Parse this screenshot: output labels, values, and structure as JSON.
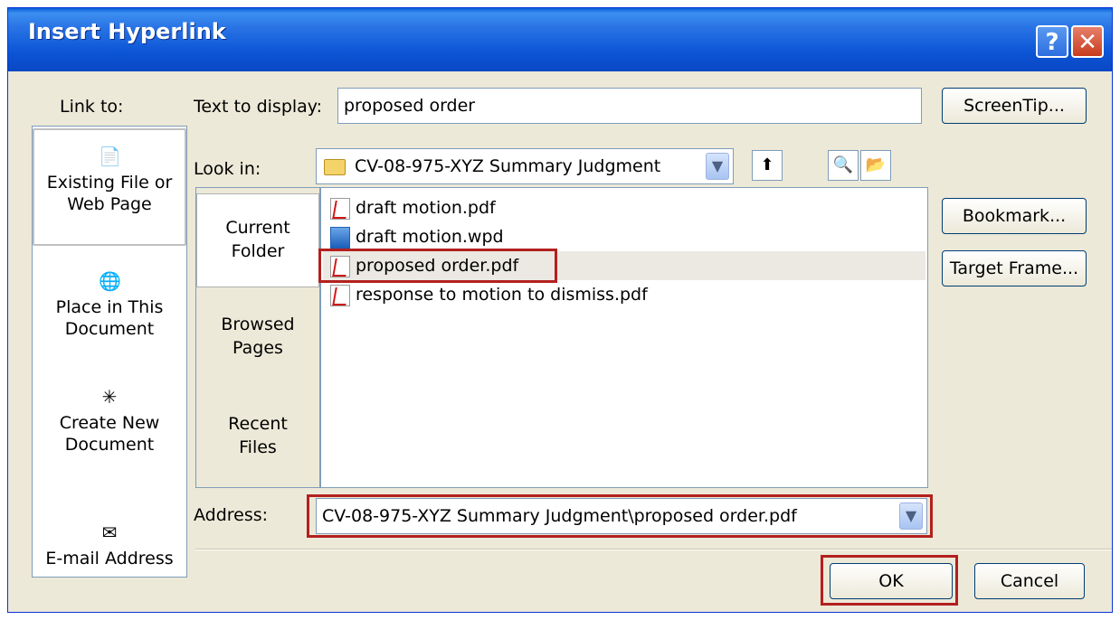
{
  "title": "Insert Hyperlink",
  "title_buttons": {
    "help": "?",
    "close": "✕"
  },
  "link_to_label": "Link to:",
  "link_to_items": [
    {
      "label_line1": "Existing File or",
      "label_line2": "Web Page",
      "icon": "existing-file-icon"
    },
    {
      "label_line1": "Place in This",
      "label_line2": "Document",
      "icon": "place-in-document-icon"
    },
    {
      "label_line1": "Create New",
      "label_line2": "Document",
      "icon": "new-document-icon"
    },
    {
      "label_line1": "E-mail Address",
      "icon": "email-icon"
    }
  ],
  "text_to_display": {
    "label": "Text to display:",
    "value": "proposed order"
  },
  "screentip_label": "ScreenTip...",
  "look_in": {
    "label": "Look in:",
    "value": "CV-08-975-XYZ Summary Judgment"
  },
  "folder_tabs": [
    {
      "line1": "Current",
      "line2": "Folder"
    },
    {
      "line1": "Browsed",
      "line2": "Pages"
    },
    {
      "line1": "Recent",
      "line2": "Files"
    }
  ],
  "files": [
    {
      "name": "draft motion.pdf",
      "type": "pdf"
    },
    {
      "name": "draft motion.wpd",
      "type": "wpd"
    },
    {
      "name": "proposed order.pdf",
      "type": "pdf",
      "selected": true
    },
    {
      "name": "response to motion to dismiss.pdf",
      "type": "pdf"
    }
  ],
  "bookmark_label": "Bookmark...",
  "target_frame_label": "Target Frame...",
  "address": {
    "label": "Address:",
    "value": "CV-08-975-XYZ Summary Judgment\\proposed order.pdf"
  },
  "ok_label": "OK",
  "cancel_label": "Cancel",
  "colors": {
    "titlebar": "#0a5fd8",
    "dialog_bg": "#ece9d8",
    "highlight_box": "#b3201e"
  }
}
